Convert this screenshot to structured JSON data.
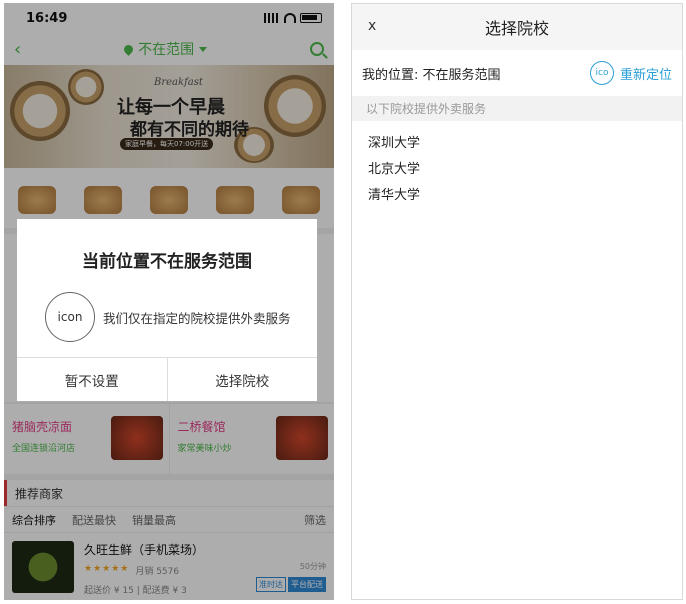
{
  "phone": {
    "status_time": "16:49",
    "header": {
      "location": "不在范围"
    },
    "banner": {
      "en": "Breakfast",
      "line1": "让每一个早晨",
      "line2": "都有不同的期待",
      "pill": "家庭早餐，每天07:00开送"
    },
    "shops": [
      {
        "name": "猪脑壳凉面",
        "sub": "全国连锁沿河店"
      },
      {
        "name": "二桥餐馆",
        "sub": "家常美味小炒"
      }
    ],
    "recommend_title": "推荐商家",
    "filters": {
      "sort": "综合排序",
      "fastest": "配送最快",
      "sales": "销量最高",
      "filter": "筛选"
    },
    "merchant": {
      "name": "久旺生鲜（手机菜场）",
      "stars": "★★★★★",
      "monthly": "月销 5576",
      "fees": "起送价 ¥ 15 | 配送费 ¥ 3",
      "time": "50分钟",
      "badge1": "准时达",
      "badge2": "平台配送"
    },
    "modal": {
      "title": "当前位置不在服务范围",
      "icon_label": "icon",
      "message": "我们仅在指定的院校提供外卖服务",
      "btn_skip": "暂不设置",
      "btn_choose": "选择院校"
    }
  },
  "panel": {
    "close": "x",
    "title": "选择院校",
    "location_label": "我的位置: 不在服务范围",
    "relocate_icon": "ico",
    "relocate": "重新定位",
    "note": "以下院校提供外卖服务",
    "schools": [
      "深圳大学",
      "北京大学",
      "清华大学"
    ]
  },
  "colors": {
    "green": "#4cba4a",
    "blue": "#2a9fd6"
  }
}
